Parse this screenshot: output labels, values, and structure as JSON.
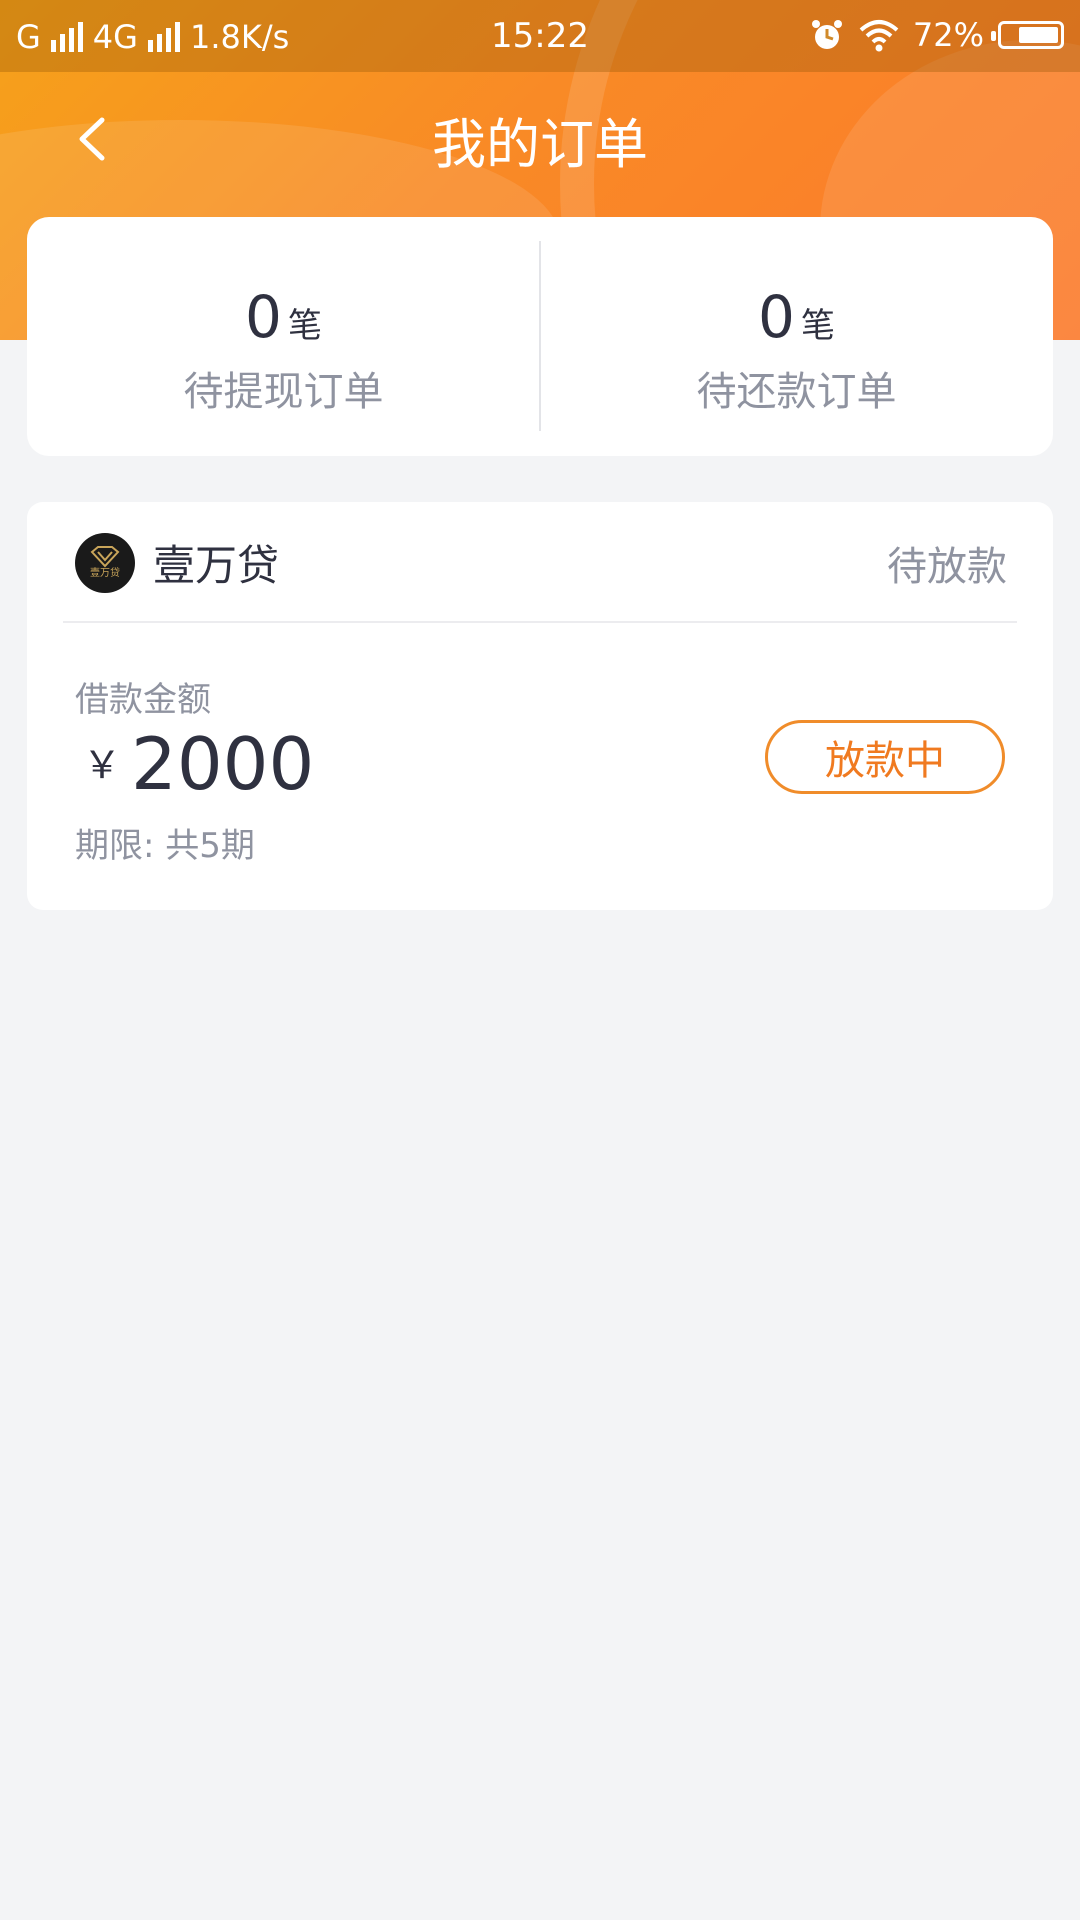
{
  "status_bar": {
    "carrier1": "G",
    "carrier2": "4G",
    "net_speed": "1.8K/s",
    "time": "15:22",
    "battery": "72%",
    "battery_level": 0.72,
    "icons": [
      "signal-icon",
      "alarm-icon",
      "wifi-icon",
      "battery-icon"
    ]
  },
  "nav": {
    "title": "我的订单",
    "back_icon": "back-arrow-icon"
  },
  "summary": {
    "withdraw": {
      "count": "0",
      "unit": "笔",
      "label": "待提现订单"
    },
    "repay": {
      "count": "0",
      "unit": "笔",
      "label": "待还款订单"
    }
  },
  "order": {
    "lender": "壹万贷",
    "logo_text": "壹万贷",
    "status": "待放款",
    "amount_label": "借款金额",
    "currency": "￥",
    "amount": "2000",
    "term": "期限: 共5期",
    "action": "放款中"
  },
  "colors": {
    "header_start": "#f6a21a",
    "header_end": "#fb7a2c",
    "accent": "#f07a20",
    "background": "#f3f4f6",
    "text_primary": "#2f3140",
    "text_secondary": "#8f93a0"
  }
}
